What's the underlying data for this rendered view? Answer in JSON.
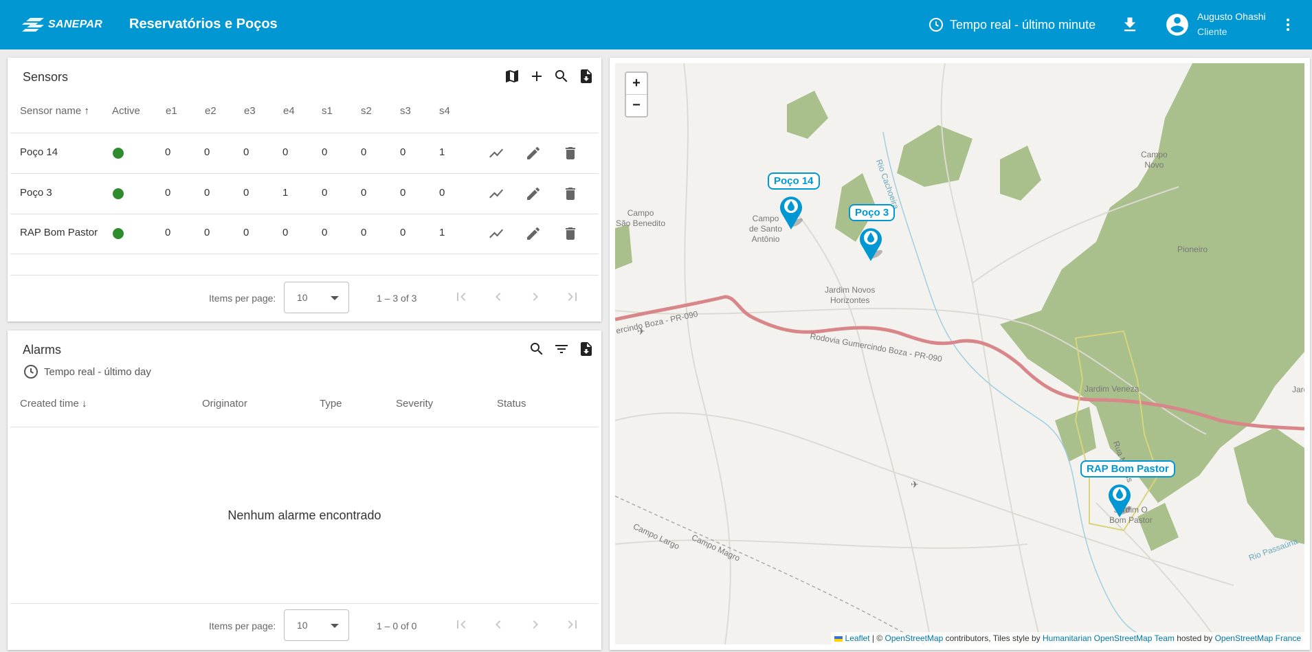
{
  "header": {
    "logo_text": "SANEPAR",
    "title": "Reservatórios e Poços",
    "realtime_label": "Tempo real - último minute",
    "user_name": "Augusto Ohashi",
    "user_role": "Cliente"
  },
  "sensors": {
    "title": "Sensors",
    "columns": [
      "Sensor name",
      "Active",
      "e1",
      "e2",
      "e3",
      "e4",
      "s1",
      "s2",
      "s3",
      "s4"
    ],
    "rows": [
      {
        "name": "Poço 14",
        "active": true,
        "e1": "0",
        "e2": "0",
        "e3": "0",
        "e4": "0",
        "s1": "0",
        "s2": "0",
        "s3": "0",
        "s4": "1"
      },
      {
        "name": "Poço 3",
        "active": true,
        "e1": "0",
        "e2": "0",
        "e3": "0",
        "e4": "1",
        "s1": "0",
        "s2": "0",
        "s3": "0",
        "s4": "0"
      },
      {
        "name": "RAP Bom Pastor",
        "active": true,
        "e1": "0",
        "e2": "0",
        "e3": "0",
        "e4": "0",
        "s1": "0",
        "s2": "0",
        "s3": "0",
        "s4": "1"
      }
    ],
    "items_per_page_label": "Items per page:",
    "items_per_page": "10",
    "range": "1 – 3 of 3"
  },
  "alarms": {
    "title": "Alarms",
    "realtime_label": "Tempo real - último day",
    "columns": [
      "Created time",
      "Originator",
      "Type",
      "Severity",
      "Status"
    ],
    "empty_text": "Nenhum alarme encontrado",
    "items_per_page_label": "Items per page:",
    "items_per_page": "10",
    "range": "1 – 0 of 0"
  },
  "map": {
    "zoom_in": "+",
    "zoom_out": "−",
    "markers": [
      "Poço 14",
      "Poço 3",
      "RAP Bom Pastor"
    ],
    "places": {
      "campo_sao_benedito": "Campo\nSão Benedito",
      "campo_santo_antonio": "Campo\nde Santo\nAntônio",
      "jardim_novos_horizontes": "Jardim Novos\nHorizontes",
      "campo_novo": "Campo\nNovo",
      "pioneiro": "Pioneiro",
      "jardim_veneza": "Jardim Veneza",
      "jardim_bom_pastor": "Jardim O\nBom Pastor",
      "rodovia_1": "Rodovia Gumercindo Boza - PR-090",
      "rodovia_2": "ercindo Boza - PR-090",
      "rio_cachoeira": "Rio Cachoeira",
      "campo_largo": "Campo Largo",
      "campo_magro": "Campo Magro",
      "rio_passauna": "Rio Passaúna",
      "rua": "Rua M... ilis",
      "jard": "Jard"
    },
    "attribution": {
      "leaflet": "Leaflet",
      "sep": " | © ",
      "osm": "OpenStreetMap",
      "contrib": " contributors, Tiles style by ",
      "hot": "Humanitarian OpenStreetMap Team",
      "hosted": " hosted by ",
      "osm_fr": "OpenStreetMap France"
    }
  },
  "colors": {
    "primary": "#0097d3",
    "active_dot": "#2e8b2e",
    "forest": "#a9bf8c",
    "road": "#d8868a"
  }
}
